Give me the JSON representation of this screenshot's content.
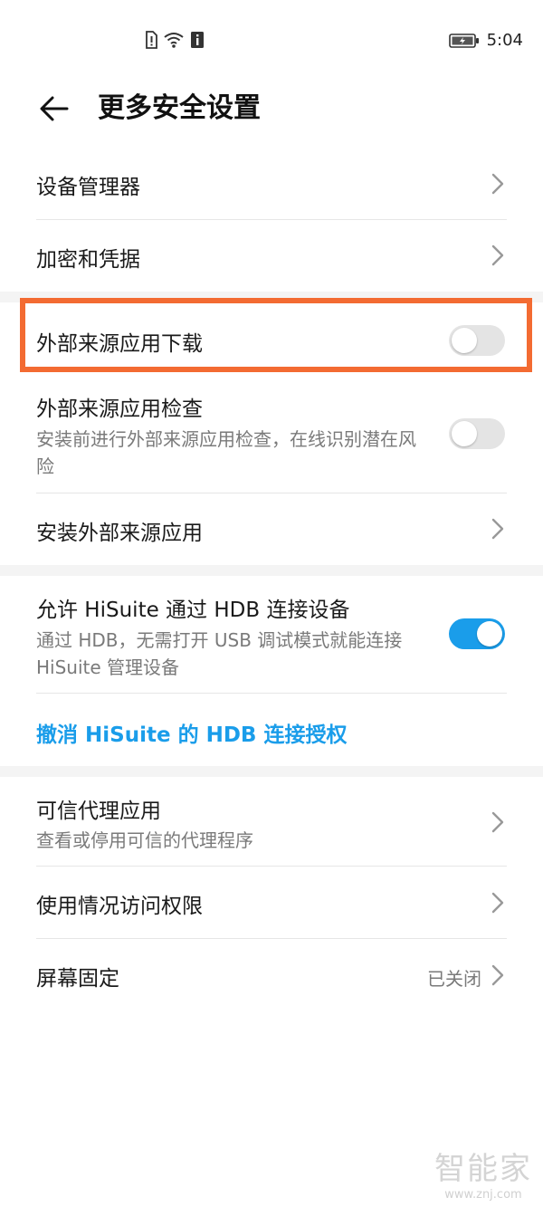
{
  "status_bar": {
    "time": "5:04"
  },
  "header": {
    "title": "更多安全设置"
  },
  "group1": {
    "device_manager": "设备管理器",
    "encryption": "加密和凭据"
  },
  "group2": {
    "external_download": {
      "label": "外部来源应用下载",
      "enabled": false
    },
    "external_check": {
      "label": "外部来源应用检查",
      "sub": "安装前进行外部来源应用检查，在线识别潜在风险",
      "enabled": false
    },
    "install_external": "安装外部来源应用"
  },
  "group3": {
    "hisuite": {
      "label": "允许 HiSuite 通过 HDB 连接设备",
      "sub": "通过 HDB，无需打开 USB 调试模式就能连接 HiSuite 管理设备",
      "enabled": true
    },
    "revoke": "撤消 HiSuite 的 HDB 连接授权"
  },
  "group4": {
    "trust_agent": {
      "label": "可信代理应用",
      "sub": "查看或停用可信的代理程序"
    },
    "usage_access": "使用情况访问权限",
    "screen_pin": {
      "label": "屏幕固定",
      "value": "已关闭"
    }
  },
  "watermark": {
    "name": "智能家",
    "url": "www.znj.com"
  },
  "colors": {
    "accent": "#1a9dea",
    "highlight": "#f36b32"
  }
}
